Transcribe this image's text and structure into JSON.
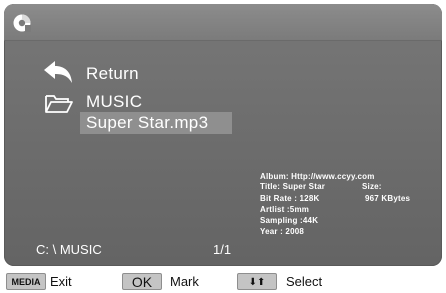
{
  "browser": {
    "return_label": "Return",
    "folder_label": "MUSIC",
    "selected_file": "Super Star.mp3",
    "selected_file_highlight_color": "#8f8f8f",
    "path": "C: \\ MUSIC",
    "page_indicator": "1/1"
  },
  "info": {
    "album": "Album: Http://www.ccyy.com",
    "title": "Title: Super Star",
    "size_label": "Size:",
    "bitrate": "Bit Rate : 128K",
    "size_value": "967 KBytes",
    "artist": "Artlist :5mm",
    "sampling": "Sampling :44K",
    "year": "Year :  2008"
  },
  "footer": {
    "media_key": "MEDIA",
    "exit_label": "Exit",
    "ok_key": "OK",
    "mark_label": "Mark",
    "arrows_key": "⬇⬆",
    "select_label": "Select"
  },
  "icons": {
    "app": "disc-icon",
    "return": "return-arrow-icon",
    "folder": "folder-icon"
  },
  "colors": {
    "panel": "#6e6e6e",
    "text": "#ffffff",
    "key_button": "#c4c4c4"
  }
}
